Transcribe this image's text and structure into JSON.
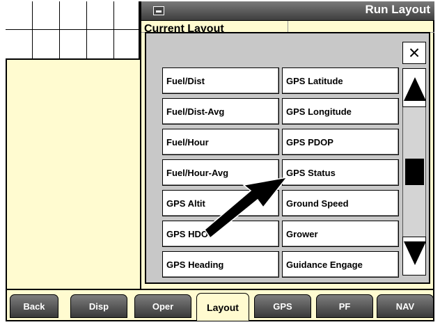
{
  "header": {
    "title": "Run Layout",
    "subtitle": "Current Layout"
  },
  "dialog": {
    "close_label": "×",
    "left_items": [
      "Fuel/Dist",
      "Fuel/Dist-Avg",
      "Fuel/Hour",
      "Fuel/Hour-Avg",
      "GPS Altit",
      "GPS HDOP",
      "GPS Heading"
    ],
    "right_items": [
      "GPS Latitude",
      "GPS Longitude",
      "GPS PDOP",
      "GPS Status",
      "Ground Speed",
      "Grower",
      "Guidance Engage"
    ]
  },
  "tabs": [
    "Back",
    "Disp",
    "Oper",
    "Layout",
    "GPS",
    "PF",
    "NAV"
  ],
  "active_tab": "Layout",
  "colors": {
    "background": "#fffbd0",
    "dialog": "#c8c8c8",
    "tab": "#5a5a5a"
  }
}
